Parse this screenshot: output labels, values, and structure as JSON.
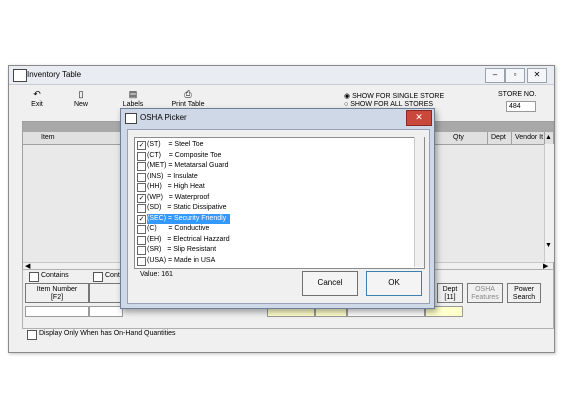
{
  "main": {
    "title": "Inventory Table",
    "toolbar": {
      "exit": "Exit",
      "new": "New",
      "labels": "Labels",
      "print_table": "Print Table"
    },
    "store_options": {
      "single": "SHOW FOR SINGLE STORE",
      "all": "SHOW FOR ALL STORES",
      "selected": "single"
    },
    "store_no_label": "STORE NO.",
    "store_no_value": "484",
    "columns": [
      "Item",
      "Qty",
      "Dept",
      "Vendor It"
    ],
    "contains_1": "Contains",
    "contains_2": "Contai",
    "buttons": {
      "item_number": "Item Number",
      "item_number_key": "[F2]",
      "dept": "Dept",
      "dept_key": "[11]",
      "osha": "OSHA",
      "osha_sub": "Features",
      "power_search": "Power Search"
    },
    "display_only": "Display Only When has On-Hand Quantities"
  },
  "dialog": {
    "title": "OSHA Picker",
    "items": [
      {
        "text": "(ST)    = Steel Toe",
        "checked": true,
        "selected": false
      },
      {
        "text": "(CT)    = Composite Toe",
        "checked": false,
        "selected": false
      },
      {
        "text": "(MET) = Metatarsal Guard",
        "checked": false,
        "selected": false
      },
      {
        "text": "(INS)  = Insulate",
        "checked": false,
        "selected": false
      },
      {
        "text": "(HH)   = High Heat",
        "checked": false,
        "selected": false
      },
      {
        "text": "(WP)   = Waterproof",
        "checked": true,
        "selected": false
      },
      {
        "text": "(SD)   = Static Dissipative",
        "checked": false,
        "selected": false
      },
      {
        "text": "(SEC) = Security Friendly",
        "checked": true,
        "selected": true
      },
      {
        "text": "(C)      = Conductive",
        "checked": false,
        "selected": false
      },
      {
        "text": "(EH)   = Electrical Hazzard",
        "checked": false,
        "selected": false
      },
      {
        "text": "(SR)   = Slip Resistant",
        "checked": false,
        "selected": false
      },
      {
        "text": "(USA) = Made in USA",
        "checked": false,
        "selected": false
      }
    ],
    "value_label": "Value: 161",
    "cancel": "Cancel",
    "ok": "OK"
  }
}
